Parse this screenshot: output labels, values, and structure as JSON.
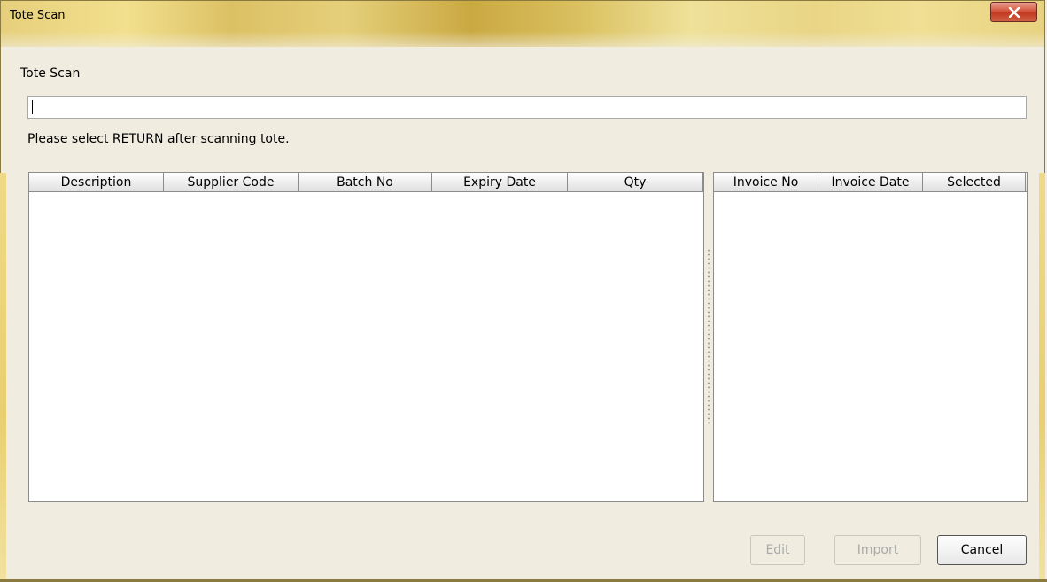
{
  "window": {
    "title": "Tote Scan",
    "close_symbol": "close-icon",
    "accent": "#e6cf7c"
  },
  "form": {
    "label": "Tote Scan",
    "input_value": "",
    "hint": "Please select RETURN after scanning tote."
  },
  "items_table": {
    "columns": [
      "Description",
      "Supplier Code",
      "Batch No",
      "Expiry Date",
      "Qty"
    ],
    "rows": []
  },
  "invoice_table": {
    "columns": [
      "Invoice No",
      "Invoice Date",
      "Selected"
    ],
    "rows": []
  },
  "buttons": {
    "edit": "Edit",
    "import": "Import",
    "cancel": "Cancel"
  }
}
